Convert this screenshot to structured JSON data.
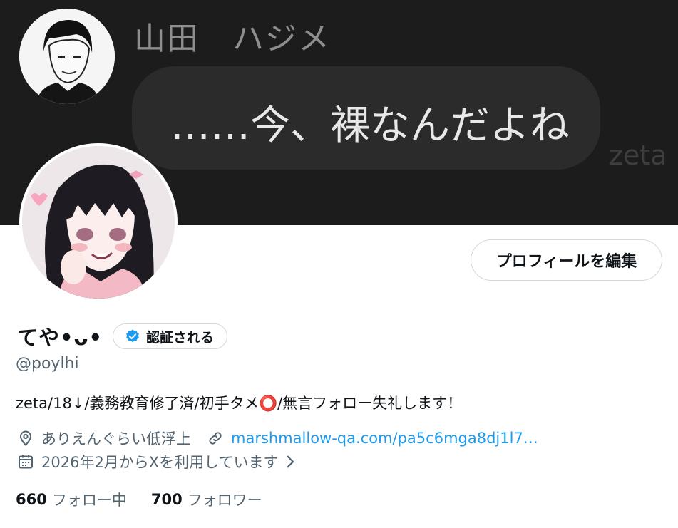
{
  "banner": {
    "sender_name": "山田　ハジメ",
    "message": "……今、裸なんだよね",
    "watermark": "zeta"
  },
  "profile": {
    "edit_button": "プロフィールを編集",
    "display_name": "てや•ᴗ•",
    "verify_label": "認証される",
    "handle": "@poylhi",
    "bio": "zeta/18↓/義務教育修了済/初手タメ⭕️/無言フォロー失礼します！",
    "location": "ありえんぐらい低浮上",
    "link": "marshmallow-qa.com/pa5c6mga8dj1l7…",
    "joined": "2026年2月からXを利用しています",
    "following_count": "660",
    "following_label": "フォロー中",
    "followers_count": "700",
    "followers_label": "フォロワー"
  },
  "icons": {
    "location": "map-pin-icon",
    "link": "link-icon",
    "calendar": "calendar-icon",
    "verified": "verified-badge-icon",
    "chevron": "chevron-right-icon"
  },
  "colors": {
    "accent": "#1d9bf0",
    "secondary_text": "#536471",
    "border": "#cfd9de",
    "banner_bg": "#1c1c1c"
  }
}
